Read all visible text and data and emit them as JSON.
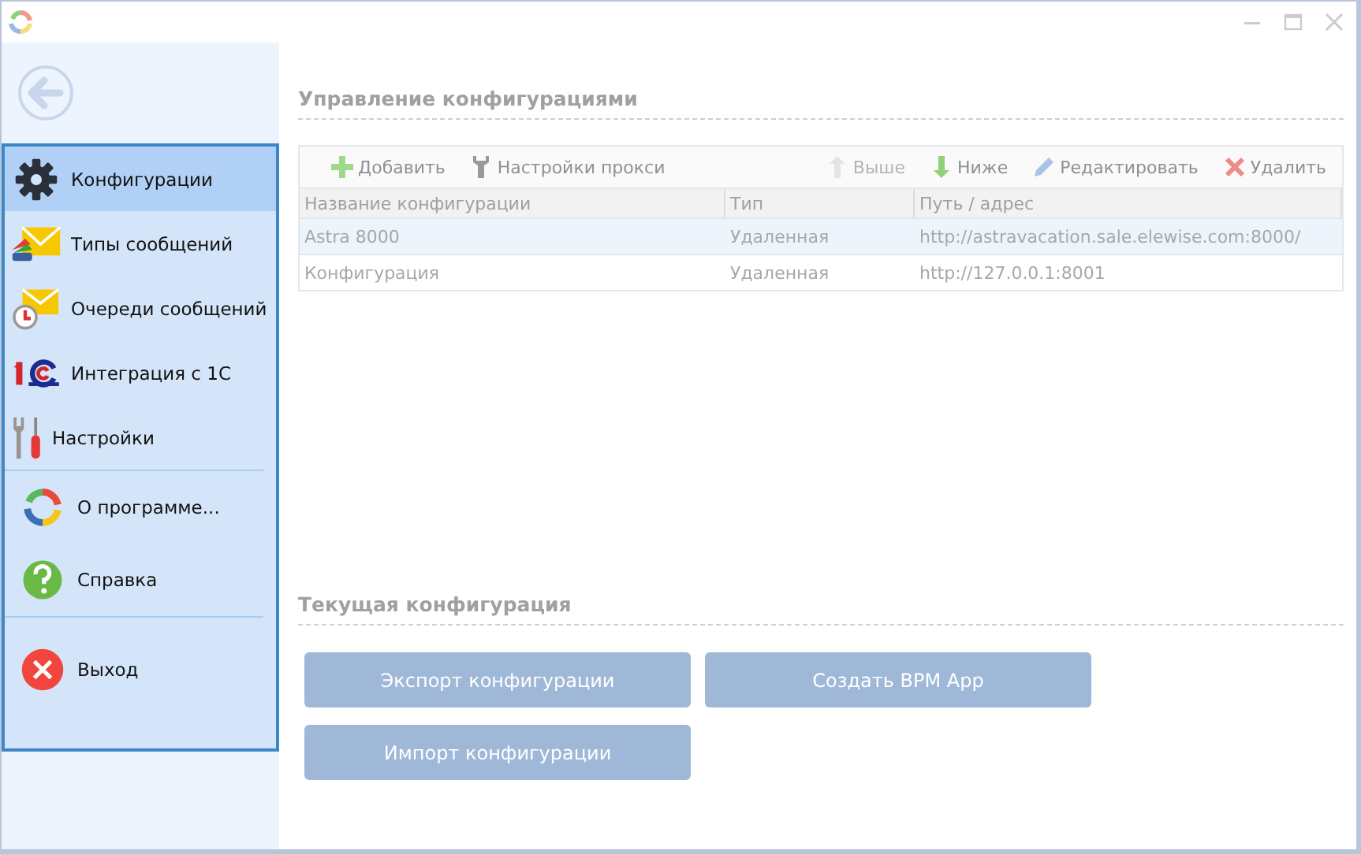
{
  "sidebar": {
    "groups": [
      [
        {
          "label": "Конфигурации",
          "kind": "gear",
          "selected": true
        },
        {
          "label": "Типы сообщений",
          "kind": "mail-types",
          "selected": false
        },
        {
          "label": "Очереди сообщений",
          "kind": "mail-queue",
          "selected": false
        },
        {
          "label": "Интеграция с 1С",
          "kind": "logo",
          "selected": false
        },
        {
          "label": "Настройки",
          "kind": "tools",
          "selected": false
        }
      ],
      [
        {
          "label": "О программе...",
          "kind": "cycle",
          "selected": false
        },
        {
          "label": "Справка",
          "kind": "help",
          "selected": false
        }
      ],
      [
        {
          "label": "Выход",
          "kind": "exit",
          "selected": false
        }
      ]
    ]
  },
  "config_management": {
    "title": "Управление конфигурациями",
    "toolbar": {
      "left": [
        {
          "label": "Добавить",
          "kind": "plus",
          "disabled": false
        },
        {
          "label": "Настройки прокси",
          "kind": "wrench",
          "disabled": false
        }
      ],
      "right": [
        {
          "label": "Выше",
          "kind": "up",
          "disabled": true
        },
        {
          "label": "Ниже",
          "kind": "down",
          "disabled": false
        },
        {
          "label": "Редактировать",
          "kind": "pencil",
          "disabled": false
        },
        {
          "label": "Удалить",
          "kind": "delete",
          "disabled": false
        }
      ]
    },
    "table": {
      "columns": [
        "Название конфигурации",
        "Тип",
        "Путь / адрес"
      ],
      "rows": [
        {
          "cells": [
            "Astra 8000",
            "Удаленная",
            "http://astravacation.sale.elewise.com:8000/"
          ],
          "selected": true
        },
        {
          "cells": [
            "Конфигурация",
            "Удаленная",
            "http://127.0.0.1:8001"
          ],
          "selected": false
        }
      ]
    }
  },
  "current_configuration": {
    "title": "Текущая конфигурация",
    "buttons": [
      "Экспорт конфигурации",
      "Создать BPM App",
      "Импорт конфигурации"
    ]
  }
}
